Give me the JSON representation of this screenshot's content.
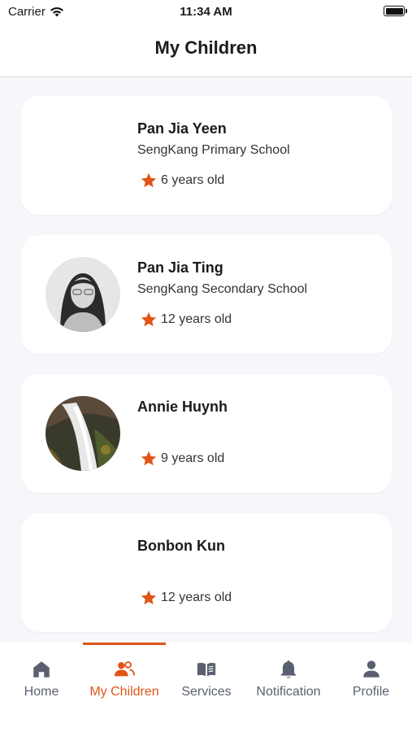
{
  "status_bar": {
    "carrier": "Carrier",
    "time": "11:34 AM"
  },
  "header": {
    "title": "My Children"
  },
  "children": [
    {
      "name": "Pan Jia Yeen",
      "school": "SengKang Primary School",
      "age": "6 years old",
      "avatar": "none"
    },
    {
      "name": "Pan Jia Ting",
      "school": "SengKang Secondary School",
      "age": "12 years old",
      "avatar": "portrait-photo"
    },
    {
      "name": "Annie Huynh",
      "school": "",
      "age": "9 years old",
      "avatar": "waterfall-photo"
    },
    {
      "name": "Bonbon Kun",
      "school": "",
      "age": "12 years old",
      "avatar": "none"
    }
  ],
  "tabs": [
    {
      "label": "Home",
      "icon": "home-icon",
      "active": false
    },
    {
      "label": "My Children",
      "icon": "people-icon",
      "active": true
    },
    {
      "label": "Services",
      "icon": "book-icon",
      "active": false
    },
    {
      "label": "Notification",
      "icon": "bell-icon",
      "active": false
    },
    {
      "label": "Profile",
      "icon": "person-icon",
      "active": false
    }
  ],
  "colors": {
    "accent": "#e15517",
    "inactive_tab": "#5a6070",
    "background": "#f6f7fa",
    "star": "#e15517"
  }
}
